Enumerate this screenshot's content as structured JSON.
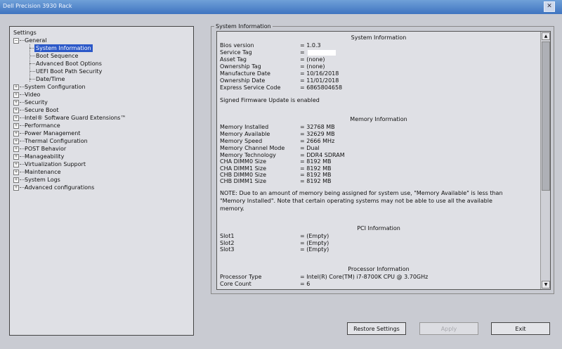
{
  "window": {
    "title": "Dell Precision 3930 Rack",
    "close_glyph": "✕"
  },
  "settings_tree": {
    "root_label": "Settings",
    "general": {
      "label": "General",
      "children": [
        "System Information",
        "Boot Sequence",
        "Advanced Boot Options",
        "UEFI Boot Path Security",
        "Date/Time"
      ]
    },
    "items": [
      "System Configuration",
      "Video",
      "Security",
      "Secure Boot",
      "Intel® Software Guard Extensions™",
      "Performance",
      "Power Management",
      "Thermal Configuration",
      "POST Behavior",
      "Manageability",
      "Virtualization Support",
      "Maintenance",
      "System Logs",
      "Advanced configurations"
    ]
  },
  "info": {
    "group_title": "System Information",
    "system": {
      "heading": "System Information",
      "rows": [
        {
          "k": "Bios version",
          "v": "= 1.0.3"
        },
        {
          "k": "Service Tag",
          "v": "="
        },
        {
          "k": "Asset Tag",
          "v": "= (none)"
        },
        {
          "k": "Ownership Tag",
          "v": "= (none)"
        },
        {
          "k": "Manufacture Date",
          "v": "= 10/16/2018"
        },
        {
          "k": "Ownership Date",
          "v": "= 11/01/2018"
        },
        {
          "k": "Express Service Code",
          "v": "= 6865804658"
        }
      ],
      "note": "Signed Firmware Update is enabled"
    },
    "memory": {
      "heading": "Memory Information",
      "rows": [
        {
          "k": "Memory Installed",
          "v": "= 32768 MB"
        },
        {
          "k": "Memory Available",
          "v": "= 32629 MB"
        },
        {
          "k": "Memory Speed",
          "v": "= 2666 MHz"
        },
        {
          "k": "Memory Channel Mode",
          "v": "= Dual"
        },
        {
          "k": "Memory Technology",
          "v": "= DDR4 SDRAM"
        },
        {
          "k": "CHA DIMM0 Size",
          "v": "= 8192 MB"
        },
        {
          "k": "CHA DIMM1 Size",
          "v": "= 8192 MB"
        },
        {
          "k": "CHB DIMM0 Size",
          "v": "= 8192 MB"
        },
        {
          "k": "CHB DIMM1 Size",
          "v": "= 8192 MB"
        }
      ],
      "note": "NOTE: Due to an amount of memory being assigned for system use, \"Memory Available\" is less than \"Memory Installed\". Note that certain operating systems may not be able to use all the available memory."
    },
    "pci": {
      "heading": "PCI Information",
      "rows": [
        {
          "k": "Slot1",
          "v": "= (Empty)"
        },
        {
          "k": "Slot2",
          "v": "= (Empty)"
        },
        {
          "k": "Slot3",
          "v": "= (Empty)"
        }
      ]
    },
    "processor": {
      "heading": "Processor Information",
      "rows": [
        {
          "k": "Processor Type",
          "v": "= Intel(R) Core(TM) i7-8700K CPU @ 3.70GHz"
        },
        {
          "k": "Core Count",
          "v": "= 6"
        }
      ]
    }
  },
  "buttons": {
    "restore": "Restore Settings",
    "apply": "Apply",
    "exit": "Exit"
  }
}
